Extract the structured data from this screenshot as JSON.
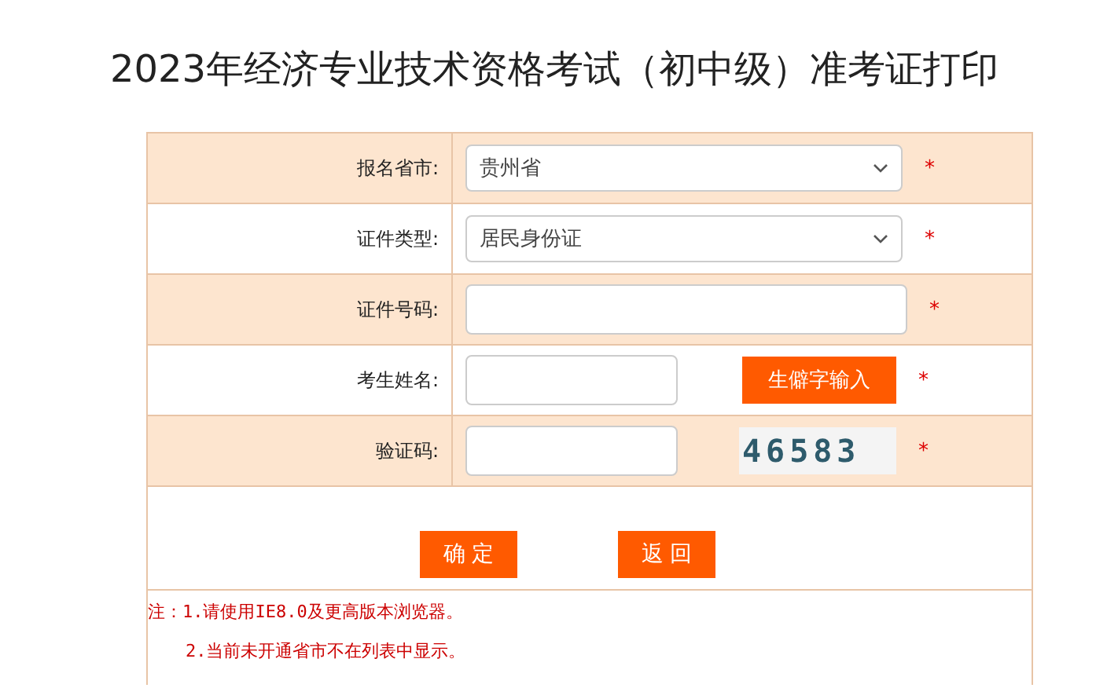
{
  "title": "2023年经济专业技术资格考试（初中级）准考证打印",
  "rows": [
    {
      "label": "报名省市:",
      "kind": "select",
      "value": "贵州省",
      "required": "*"
    },
    {
      "label": "证件类型:",
      "kind": "select",
      "value": "居民身份证",
      "required": "*"
    },
    {
      "label": "证件号码:",
      "kind": "input",
      "required": "*"
    },
    {
      "label": "考生姓名:",
      "kind": "input_button",
      "button": "生僻字输入",
      "required": "*"
    },
    {
      "label": "验证码:",
      "kind": "input_captcha",
      "captcha": "46583",
      "required": "*"
    }
  ],
  "buttons": [
    "确 定",
    "返 回"
  ],
  "notes": [
    "注：1.请使用IE8.0及更高版本浏览器。",
    "2.当前未开通省市不在列表中显示。"
  ]
}
